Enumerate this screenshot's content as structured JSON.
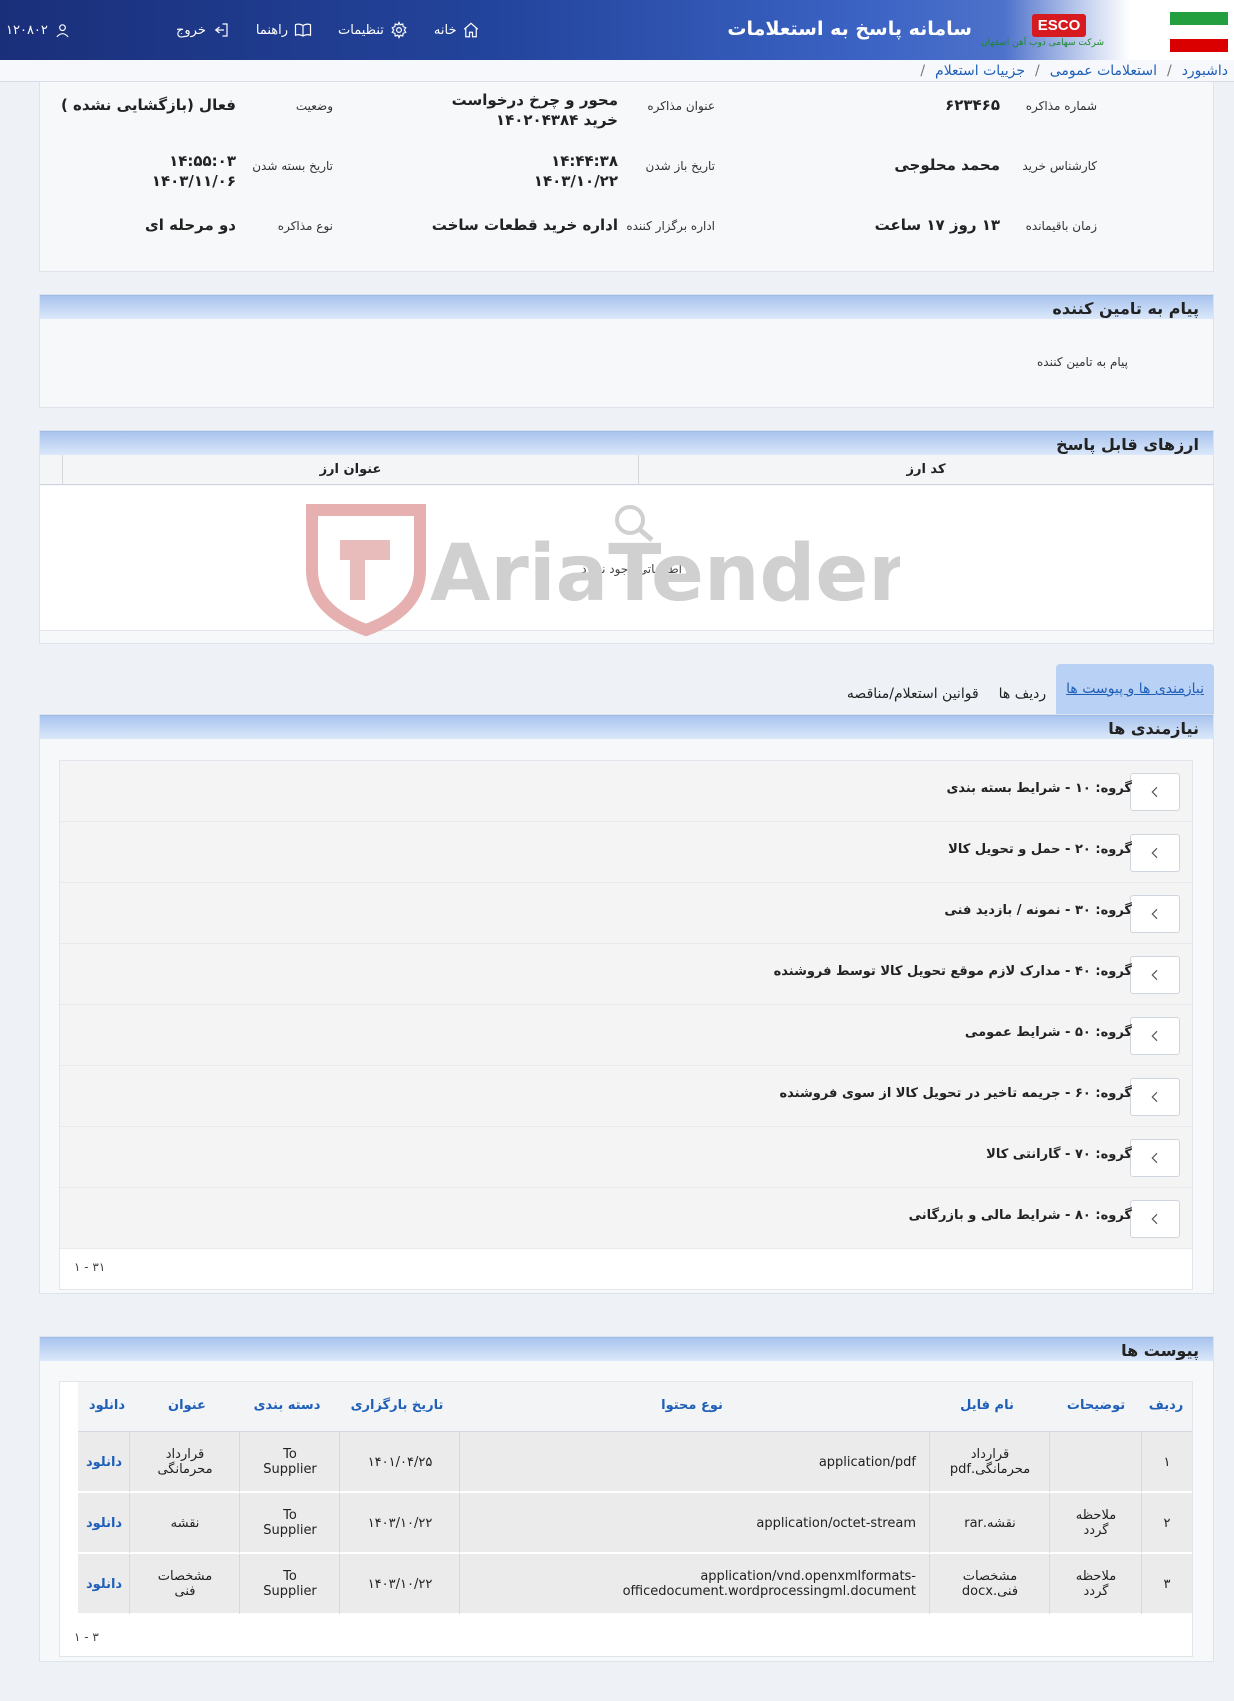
{
  "header": {
    "app_title": "سامانه پاسخ به استعلامات",
    "company_logo_text": "ESCO",
    "company_name": "شرکت سهامی ذوب آهن اصفهان",
    "nav": {
      "home": "خانه",
      "settings": "تنظیمات",
      "guide": "راهنما",
      "logout": "خروج"
    },
    "user_id": "۱۲۰۸۰۲"
  },
  "breadcrumb": {
    "items": [
      "داشبورد",
      "استعلامات عمومی",
      "جزییات استعلام"
    ]
  },
  "info": {
    "labels": {
      "negotiation_number": "شماره مذاکره",
      "negotiation_title": "عنوان مذاکره",
      "status": "وضعیت",
      "purchase_expert": "کارشناس خرید",
      "open_date": "تاریخ باز شدن",
      "close_date": "تاریخ بسته شدن",
      "remaining_time": "زمان باقیمانده",
      "organizer": "اداره برگزار کننده",
      "negotiation_type": "نوع مذاکره"
    },
    "values": {
      "negotiation_number": "۶۲۳۴۶۵",
      "negotiation_title_line1": "محور و چرخ درخواست",
      "negotiation_title_line2": "خرید ۱۴۰۲۰۴۳۸۴",
      "status": "فعال (بازگشایی نشده )",
      "purchase_expert": "محمد محلوجی",
      "open_time": "۱۴:۴۴:۳۸",
      "open_date": "۱۴۰۳/۱۰/۲۲",
      "close_time": "۱۴:۵۵:۰۳",
      "close_date": "۱۴۰۳/۱۱/۰۶",
      "remaining_time": "۱۳ روز ۱۷ ساعت",
      "organizer": "اداره خرید قطعات ساخت",
      "negotiation_type": "دو مرحله ای"
    }
  },
  "supplier_message": {
    "title": "پیام به تامین کننده",
    "text": "پیام به تامین کننده"
  },
  "currencies": {
    "title": "ارزهای قابل پاسخ",
    "columns": [
      "کد ارز",
      "عنوان ارز"
    ],
    "empty_text": "اطلاعاتی وجود ندارد"
  },
  "watermark": "AriaTender.neT",
  "tabs": [
    "نیازمندی ها و پیوست ها",
    "ردیف ها",
    "قوانین استعلام/مناقصه"
  ],
  "requirements": {
    "title": "نیازمندی ها",
    "groups": [
      "گروه: ۱۰ - شرایط بسته بندی",
      "گروه: ۲۰ - حمل و تحویل کالا",
      "گروه: ۳۰ - نمونه / بازدید فنی",
      "گروه: ۴۰ - مدارک لازم موقع تحویل کالا توسط فروشنده",
      "گروه: ۵۰ - شرایط عمومی",
      "گروه: ۶۰ - جریمه تاخیر در تحویل کالا از سوی فروشنده",
      "گروه: ۷۰ - گارانتی کالا",
      "گروه: ۸۰ - شرایط مالی و بازرگانی"
    ],
    "pager": "۱ - ۳۱"
  },
  "attachments": {
    "title": "پیوست ها",
    "columns": [
      "ردیف",
      "توضیحات",
      "نام فایل",
      "نوع محتوا",
      "تاریخ بارگزاری",
      "دسته بندی",
      "عنوان",
      "دانلود"
    ],
    "rows": [
      {
        "index": "۱",
        "description": "",
        "file_name": "قرارداد محرمانگی.pdf",
        "content_type": "application/pdf",
        "upload_date": "۱۴۰۱/۰۴/۲۵",
        "category": "To Supplier",
        "title": "قرارداد محرمانگی",
        "download": "دانلود"
      },
      {
        "index": "۲",
        "description": "ملاحظه گردد",
        "file_name": "نقشه.rar",
        "content_type": "application/octet-stream",
        "upload_date": "۱۴۰۳/۱۰/۲۲",
        "category": "To Supplier",
        "title": "نقشه",
        "download": "دانلود"
      },
      {
        "index": "۳",
        "description": "ملاحظه گردد",
        "file_name": "مشخصات فنی.docx",
        "content_type": "application/vnd.openxmlformats-officedocument.wordprocessingml.document",
        "upload_date": "۱۴۰۳/۱۰/۲۲",
        "category": "To Supplier",
        "title": "مشخصات فنی",
        "download": "دانلود"
      }
    ],
    "pager": "۱ - ۳"
  }
}
